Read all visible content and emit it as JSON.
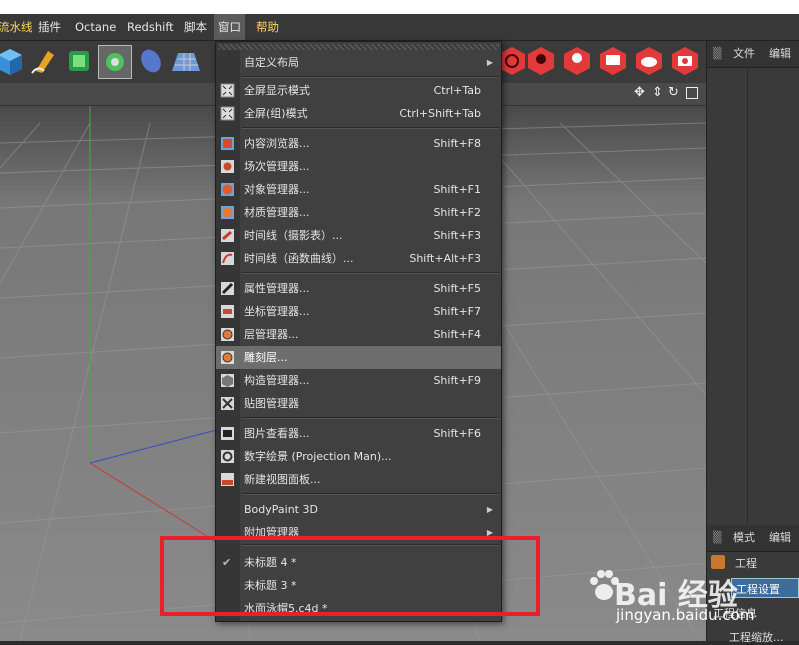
{
  "menubar": {
    "items": [
      {
        "label": "流水线"
      },
      {
        "label": "插件"
      },
      {
        "label": "Octane"
      },
      {
        "label": "Redshift"
      },
      {
        "label": "脚本"
      },
      {
        "label": "窗口"
      },
      {
        "label": "帮助"
      }
    ]
  },
  "right_panel": {
    "top_tabs": [
      "文件",
      "编辑"
    ],
    "bottom_tabs": [
      "模式",
      "编辑"
    ],
    "tree": [
      "工程",
      "工程设置",
      "工程信息",
      "工程缩放..."
    ]
  },
  "window_menu": {
    "items": [
      {
        "label": "自定义布局",
        "shortcut": "",
        "submenu": true,
        "icon": ""
      },
      {
        "label": "全屏显示模式",
        "shortcut": "Ctrl+Tab",
        "icon": "fullscreen-icon"
      },
      {
        "label": "全屏(组)模式",
        "shortcut": "Ctrl+Shift+Tab",
        "icon": "fullscreen-group-icon"
      },
      {
        "label": "内容浏览器...",
        "shortcut": "Shift+F8",
        "icon": "content-browser-icon"
      },
      {
        "label": "场次管理器...",
        "shortcut": "",
        "icon": "take-manager-icon"
      },
      {
        "label": "对象管理器...",
        "shortcut": "Shift+F1",
        "icon": "object-manager-icon"
      },
      {
        "label": "材质管理器...",
        "shortcut": "Shift+F2",
        "icon": "material-manager-icon"
      },
      {
        "label": "时间线（摄影表）...",
        "shortcut": "Shift+F3",
        "icon": "timeline-dopesheet-icon"
      },
      {
        "label": "时间线（函数曲线）...",
        "shortcut": "Shift+Alt+F3",
        "icon": "timeline-fcurve-icon"
      },
      {
        "label": "属性管理器...",
        "shortcut": "Shift+F5",
        "icon": "attribute-manager-icon"
      },
      {
        "label": "坐标管理器...",
        "shortcut": "Shift+F7",
        "icon": "coordinate-manager-icon"
      },
      {
        "label": "层管理器...",
        "shortcut": "Shift+F4",
        "icon": "layer-manager-icon"
      },
      {
        "label": "雕刻层...",
        "shortcut": "",
        "icon": "sculpt-layer-icon",
        "highlight": true
      },
      {
        "label": "构造管理器...",
        "shortcut": "Shift+F9",
        "icon": "structure-manager-icon"
      },
      {
        "label": "贴图管理器",
        "shortcut": "",
        "icon": "texture-manager-icon"
      },
      {
        "label": "图片查看器...",
        "shortcut": "Shift+F6",
        "icon": "picture-viewer-icon"
      },
      {
        "label": "数字绘景 (Projection Man)...",
        "shortcut": "",
        "icon": "projection-man-icon"
      },
      {
        "label": "新建视图面板...",
        "shortcut": "",
        "icon": "new-view-panel-icon"
      },
      {
        "label": "BodyPaint 3D",
        "shortcut": "",
        "submenu": true,
        "icon": ""
      },
      {
        "label": "附加管理器",
        "shortcut": "",
        "submenu": true,
        "icon": ""
      },
      {
        "label": "未标题 4 *",
        "shortcut": "",
        "checked": true,
        "icon": ""
      },
      {
        "label": "未标题 3 *",
        "shortcut": "",
        "icon": ""
      },
      {
        "label": "水面泳帽5.c4d *",
        "shortcut": "",
        "icon": ""
      }
    ]
  },
  "watermark": {
    "brand": "Bai 经验",
    "url": "jingyan.baidu.com"
  },
  "colors": {
    "accent_red": "#e8202a",
    "menu_bg": "#404040",
    "highlight": "#6d6d6d"
  }
}
